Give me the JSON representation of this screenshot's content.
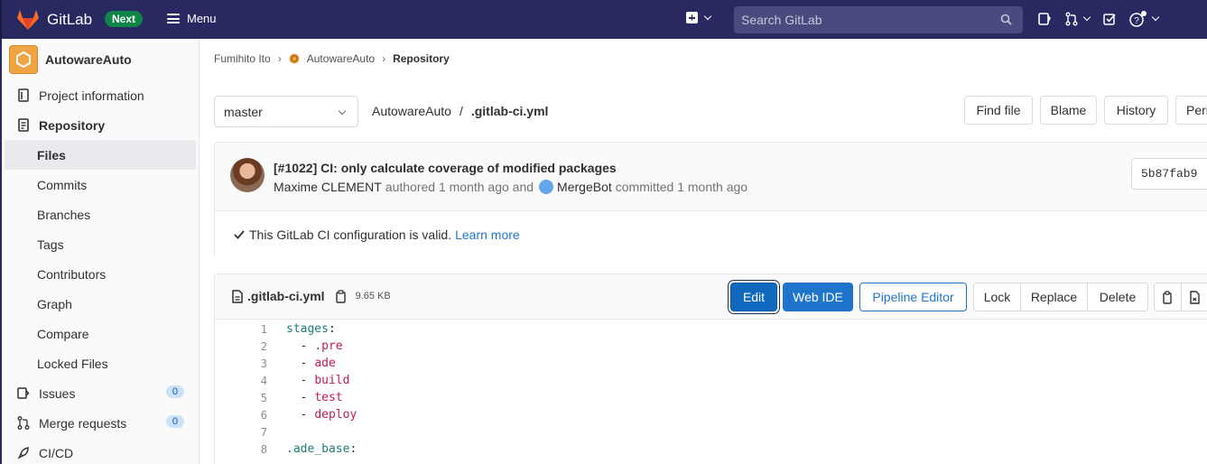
{
  "nav": {
    "brand": "GitLab",
    "badge": "Next",
    "menu_label": "Menu",
    "search_placeholder": "Search GitLab"
  },
  "sidebar": {
    "project_name": "AutowareAuto",
    "items": [
      {
        "label": "Project information",
        "icon": "project-info-icon"
      },
      {
        "label": "Repository",
        "icon": "repository-icon"
      },
      {
        "label": "Files",
        "active": true
      },
      {
        "label": "Commits"
      },
      {
        "label": "Branches"
      },
      {
        "label": "Tags"
      },
      {
        "label": "Contributors"
      },
      {
        "label": "Graph"
      },
      {
        "label": "Compare"
      },
      {
        "label": "Locked Files"
      },
      {
        "label": "Issues",
        "icon": "issues-icon",
        "count": "0"
      },
      {
        "label": "Merge requests",
        "icon": "merge-request-icon",
        "count": "0"
      },
      {
        "label": "CI/CD",
        "icon": "rocket-icon"
      }
    ]
  },
  "breadcrumb": {
    "user": "Fumihito Ito",
    "project": "AutowareAuto",
    "current": "Repository"
  },
  "toolbar": {
    "branch": "master",
    "path_project": "AutowareAuto",
    "path_sep": "/",
    "path_file": ".gitlab-ci.yml",
    "find_file": "Find file",
    "blame": "Blame",
    "history": "History",
    "permalink": "Perma"
  },
  "commit": {
    "title": "[#1022] CI: only calculate coverage of modified packages",
    "author": "Maxime CLEMENT",
    "authored": "authored 1 month ago and",
    "committer": "MergeBot",
    "committed": "committed 1 month ago",
    "sha": "5b87fab9",
    "ci_status": "This GitLab CI configuration is valid.",
    "learn_more": "Learn more"
  },
  "file": {
    "name": ".gitlab-ci.yml",
    "size": "9.65 KB",
    "edit": "Edit",
    "web_ide": "Web IDE",
    "pipeline_editor": "Pipeline Editor",
    "lock": "Lock",
    "replace": "Replace",
    "delete": "Delete"
  },
  "code_lines": [
    {
      "n": "1",
      "key": "stages",
      "val": ""
    },
    {
      "n": "2",
      "dash": true,
      "val": ".pre"
    },
    {
      "n": "3",
      "dash": true,
      "val": "ade"
    },
    {
      "n": "4",
      "dash": true,
      "val": "build"
    },
    {
      "n": "5",
      "dash": true,
      "val": "test"
    },
    {
      "n": "6",
      "dash": true,
      "val": "deploy"
    },
    {
      "n": "7",
      "blank": true
    },
    {
      "n": "8",
      "key": ".ade_base",
      "val": ""
    }
  ],
  "colors": {
    "nav_bg": "#292961",
    "accent_blue": "#1f75cb",
    "badge_green": "#108548"
  }
}
